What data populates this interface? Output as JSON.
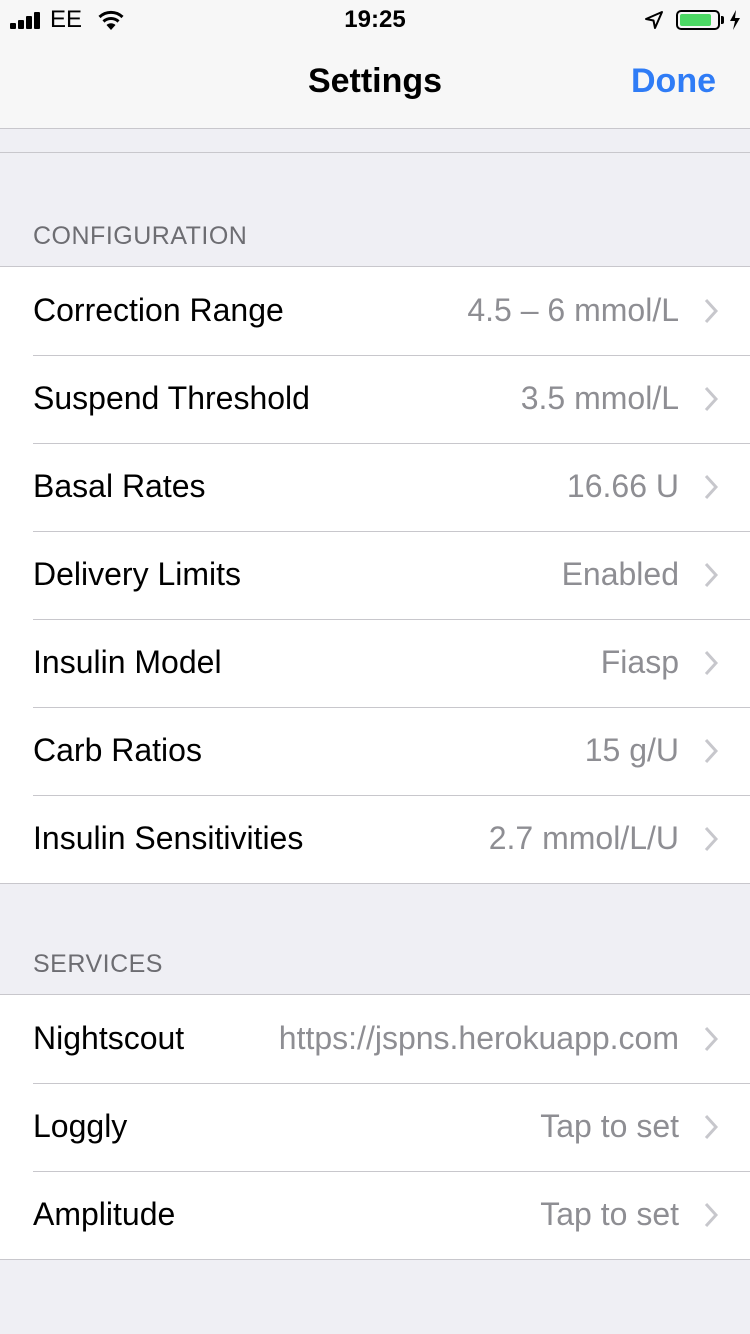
{
  "status_bar": {
    "carrier": "EE",
    "time": "19:25",
    "battery_level": 0.85,
    "icons": [
      "signal-icon",
      "wifi-icon",
      "location-icon",
      "battery-icon",
      "charging-icon"
    ]
  },
  "nav": {
    "title": "Settings",
    "done_label": "Done"
  },
  "colors": {
    "accent": "#2f7cf6",
    "battery": "#4cd964",
    "background": "#efeff4"
  },
  "sections": {
    "configuration": {
      "header": "CONFIGURATION",
      "rows": [
        {
          "label": "Correction Range",
          "value": "4.5 – 6 mmol/L"
        },
        {
          "label": "Suspend Threshold",
          "value": "3.5 mmol/L"
        },
        {
          "label": "Basal Rates",
          "value": "16.66 U"
        },
        {
          "label": "Delivery Limits",
          "value": "Enabled"
        },
        {
          "label": "Insulin Model",
          "value": "Fiasp"
        },
        {
          "label": "Carb Ratios",
          "value": "15 g/U"
        },
        {
          "label": "Insulin Sensitivities",
          "value": "2.7 mmol/L/U"
        }
      ]
    },
    "services": {
      "header": "SERVICES",
      "rows": [
        {
          "label": "Nightscout",
          "value": "https://jspns.herokuapp.com"
        },
        {
          "label": "Loggly",
          "value": "Tap to set"
        },
        {
          "label": "Amplitude",
          "value": "Tap to set"
        }
      ]
    }
  }
}
